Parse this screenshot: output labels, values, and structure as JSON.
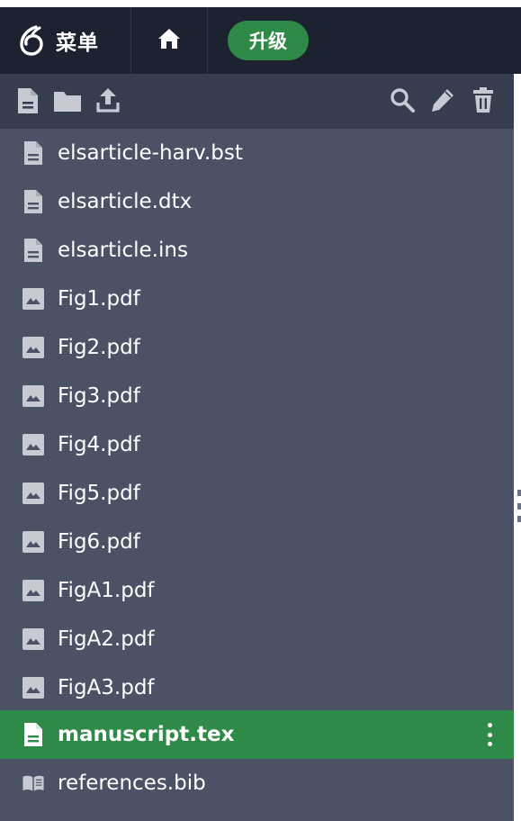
{
  "header": {
    "menu_label": "菜单",
    "upgrade_label": "升级"
  },
  "toolbar": {
    "left_icons": [
      "new-file-icon",
      "new-folder-icon",
      "upload-icon"
    ],
    "right_icons": [
      "search-icon",
      "rename-pencil-icon",
      "delete-trash-icon"
    ]
  },
  "files": [
    {
      "name": "elsarticle-harv.bst",
      "icon": "text-file-icon"
    },
    {
      "name": "elsarticle.dtx",
      "icon": "text-file-icon"
    },
    {
      "name": "elsarticle.ins",
      "icon": "text-file-icon"
    },
    {
      "name": "Fig1.pdf",
      "icon": "image-file-icon"
    },
    {
      "name": "Fig2.pdf",
      "icon": "image-file-icon"
    },
    {
      "name": "Fig3.pdf",
      "icon": "image-file-icon"
    },
    {
      "name": "Fig4.pdf",
      "icon": "image-file-icon"
    },
    {
      "name": "Fig5.pdf",
      "icon": "image-file-icon"
    },
    {
      "name": "Fig6.pdf",
      "icon": "image-file-icon"
    },
    {
      "name": "FigA1.pdf",
      "icon": "image-file-icon"
    },
    {
      "name": "FigA2.pdf",
      "icon": "image-file-icon"
    },
    {
      "name": "FigA3.pdf",
      "icon": "image-file-icon"
    },
    {
      "name": "manuscript.tex",
      "icon": "text-file-icon",
      "selected": true
    },
    {
      "name": "references.bib",
      "icon": "book-icon"
    }
  ],
  "colors": {
    "header_bg": "#1c2230",
    "toolbar_bg": "#353d4f",
    "list_bg": "#4b5265",
    "accent_green": "#2f8a48",
    "icon_gray": "#c7cad3"
  }
}
